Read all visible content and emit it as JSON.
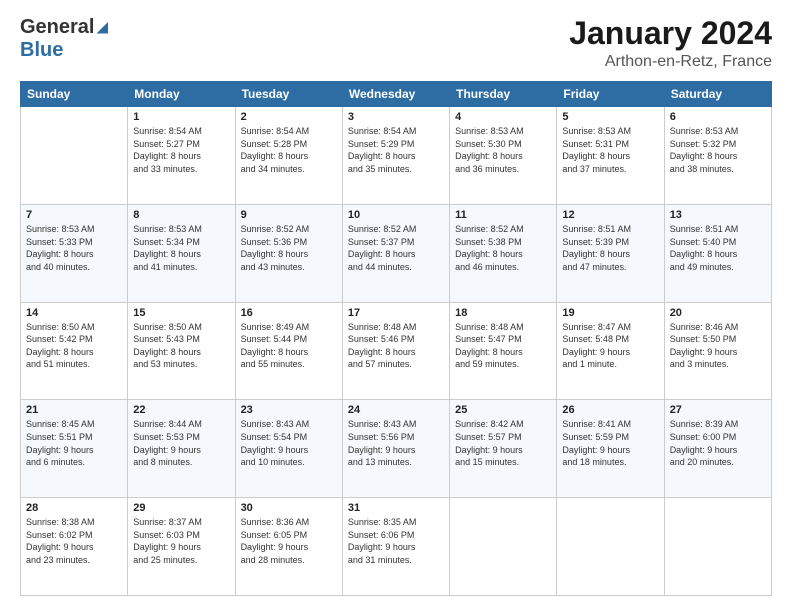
{
  "logo": {
    "line1": "General",
    "line2": "Blue"
  },
  "header": {
    "title": "January 2024",
    "subtitle": "Arthon-en-Retz, France"
  },
  "weekdays": [
    "Sunday",
    "Monday",
    "Tuesday",
    "Wednesday",
    "Thursday",
    "Friday",
    "Saturday"
  ],
  "weeks": [
    [
      {
        "day": "",
        "info": ""
      },
      {
        "day": "1",
        "info": "Sunrise: 8:54 AM\nSunset: 5:27 PM\nDaylight: 8 hours\nand 33 minutes."
      },
      {
        "day": "2",
        "info": "Sunrise: 8:54 AM\nSunset: 5:28 PM\nDaylight: 8 hours\nand 34 minutes."
      },
      {
        "day": "3",
        "info": "Sunrise: 8:54 AM\nSunset: 5:29 PM\nDaylight: 8 hours\nand 35 minutes."
      },
      {
        "day": "4",
        "info": "Sunrise: 8:53 AM\nSunset: 5:30 PM\nDaylight: 8 hours\nand 36 minutes."
      },
      {
        "day": "5",
        "info": "Sunrise: 8:53 AM\nSunset: 5:31 PM\nDaylight: 8 hours\nand 37 minutes."
      },
      {
        "day": "6",
        "info": "Sunrise: 8:53 AM\nSunset: 5:32 PM\nDaylight: 8 hours\nand 38 minutes."
      }
    ],
    [
      {
        "day": "7",
        "info": "Sunrise: 8:53 AM\nSunset: 5:33 PM\nDaylight: 8 hours\nand 40 minutes."
      },
      {
        "day": "8",
        "info": "Sunrise: 8:53 AM\nSunset: 5:34 PM\nDaylight: 8 hours\nand 41 minutes."
      },
      {
        "day": "9",
        "info": "Sunrise: 8:52 AM\nSunset: 5:36 PM\nDaylight: 8 hours\nand 43 minutes."
      },
      {
        "day": "10",
        "info": "Sunrise: 8:52 AM\nSunset: 5:37 PM\nDaylight: 8 hours\nand 44 minutes."
      },
      {
        "day": "11",
        "info": "Sunrise: 8:52 AM\nSunset: 5:38 PM\nDaylight: 8 hours\nand 46 minutes."
      },
      {
        "day": "12",
        "info": "Sunrise: 8:51 AM\nSunset: 5:39 PM\nDaylight: 8 hours\nand 47 minutes."
      },
      {
        "day": "13",
        "info": "Sunrise: 8:51 AM\nSunset: 5:40 PM\nDaylight: 8 hours\nand 49 minutes."
      }
    ],
    [
      {
        "day": "14",
        "info": "Sunrise: 8:50 AM\nSunset: 5:42 PM\nDaylight: 8 hours\nand 51 minutes."
      },
      {
        "day": "15",
        "info": "Sunrise: 8:50 AM\nSunset: 5:43 PM\nDaylight: 8 hours\nand 53 minutes."
      },
      {
        "day": "16",
        "info": "Sunrise: 8:49 AM\nSunset: 5:44 PM\nDaylight: 8 hours\nand 55 minutes."
      },
      {
        "day": "17",
        "info": "Sunrise: 8:48 AM\nSunset: 5:46 PM\nDaylight: 8 hours\nand 57 minutes."
      },
      {
        "day": "18",
        "info": "Sunrise: 8:48 AM\nSunset: 5:47 PM\nDaylight: 8 hours\nand 59 minutes."
      },
      {
        "day": "19",
        "info": "Sunrise: 8:47 AM\nSunset: 5:48 PM\nDaylight: 9 hours\nand 1 minute."
      },
      {
        "day": "20",
        "info": "Sunrise: 8:46 AM\nSunset: 5:50 PM\nDaylight: 9 hours\nand 3 minutes."
      }
    ],
    [
      {
        "day": "21",
        "info": "Sunrise: 8:45 AM\nSunset: 5:51 PM\nDaylight: 9 hours\nand 6 minutes."
      },
      {
        "day": "22",
        "info": "Sunrise: 8:44 AM\nSunset: 5:53 PM\nDaylight: 9 hours\nand 8 minutes."
      },
      {
        "day": "23",
        "info": "Sunrise: 8:43 AM\nSunset: 5:54 PM\nDaylight: 9 hours\nand 10 minutes."
      },
      {
        "day": "24",
        "info": "Sunrise: 8:43 AM\nSunset: 5:56 PM\nDaylight: 9 hours\nand 13 minutes."
      },
      {
        "day": "25",
        "info": "Sunrise: 8:42 AM\nSunset: 5:57 PM\nDaylight: 9 hours\nand 15 minutes."
      },
      {
        "day": "26",
        "info": "Sunrise: 8:41 AM\nSunset: 5:59 PM\nDaylight: 9 hours\nand 18 minutes."
      },
      {
        "day": "27",
        "info": "Sunrise: 8:39 AM\nSunset: 6:00 PM\nDaylight: 9 hours\nand 20 minutes."
      }
    ],
    [
      {
        "day": "28",
        "info": "Sunrise: 8:38 AM\nSunset: 6:02 PM\nDaylight: 9 hours\nand 23 minutes."
      },
      {
        "day": "29",
        "info": "Sunrise: 8:37 AM\nSunset: 6:03 PM\nDaylight: 9 hours\nand 25 minutes."
      },
      {
        "day": "30",
        "info": "Sunrise: 8:36 AM\nSunset: 6:05 PM\nDaylight: 9 hours\nand 28 minutes."
      },
      {
        "day": "31",
        "info": "Sunrise: 8:35 AM\nSunset: 6:06 PM\nDaylight: 9 hours\nand 31 minutes."
      },
      {
        "day": "",
        "info": ""
      },
      {
        "day": "",
        "info": ""
      },
      {
        "day": "",
        "info": ""
      }
    ]
  ]
}
